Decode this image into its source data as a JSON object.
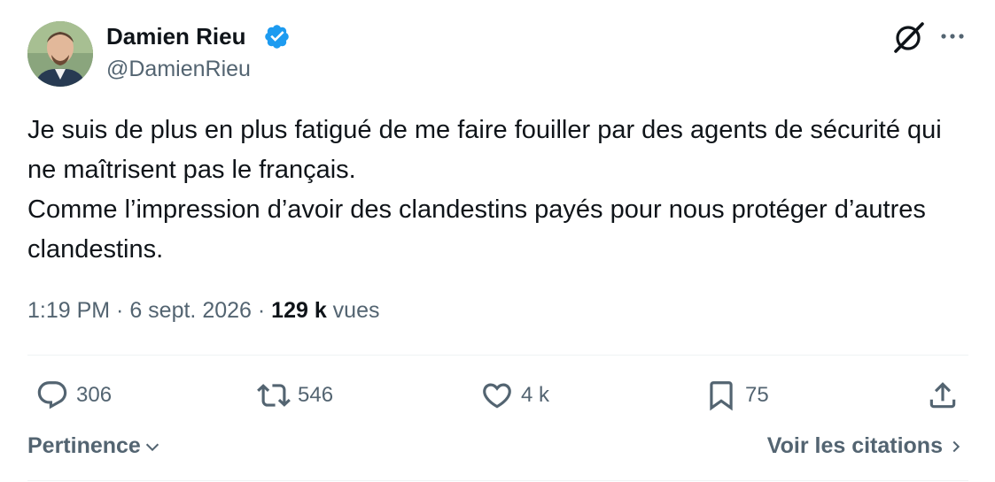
{
  "author": {
    "name": "Damien Rieu",
    "handle": "@DamienRieu",
    "verified": true,
    "verified_color": "#1d9bf0"
  },
  "tweet": {
    "text": "Je suis de plus en plus fatigué de me faire fouiller par des agents de sécurité qui ne maîtrisent pas le français.\nComme l’impression d’avoir des clandestins payés pour nous protéger d’autres clandestins.",
    "time": "1:19 PM",
    "separator": " · ",
    "date": "6 sept. 2026",
    "views_count": "129 k",
    "views_label": " vues"
  },
  "actions": {
    "replies": "306",
    "reposts": "546",
    "likes": "4 k",
    "bookmarks": "75"
  },
  "footer": {
    "sort_label": "Pertinence",
    "quotes_label": "Voir les citations"
  },
  "icons": {
    "grok": "grok-icon",
    "more": "more-icon",
    "reply": "reply-icon",
    "repost": "repost-icon",
    "like": "like-icon",
    "bookmark": "bookmark-icon",
    "share": "share-icon"
  },
  "colors": {
    "text": "#0f1419",
    "secondary": "#536471",
    "divider": "#eff3f4"
  }
}
